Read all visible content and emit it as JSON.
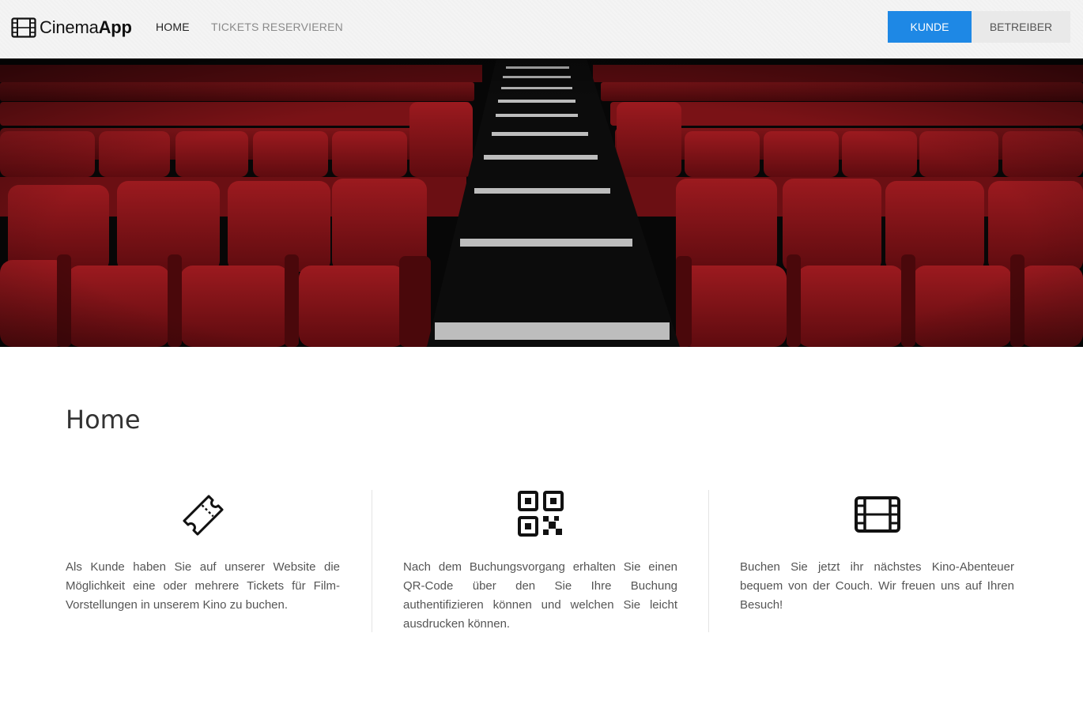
{
  "brand": {
    "name_light": "Cinema",
    "name_bold": "App",
    "icon": "film-icon"
  },
  "nav": {
    "items": [
      {
        "label": "HOME",
        "active": true
      },
      {
        "label": "TICKETS RESERVIEREN",
        "active": false
      }
    ]
  },
  "roles": {
    "kunde": "KUNDE",
    "betreiber": "BETREIBER",
    "active": "KUNDE"
  },
  "hero": {
    "image": "cinema-seats-hero"
  },
  "page": {
    "title": "Home"
  },
  "features": [
    {
      "icon": "ticket-icon",
      "text": "Als Kunde haben Sie auf unserer Website die Möglichkeit eine oder mehrere Tickets für Film-Vorstellungen in unserem Kino zu buchen."
    },
    {
      "icon": "qr-code-icon",
      "text": "Nach dem Buchungsvorgang erhalten Sie einen QR-Code über den Sie Ihre Buchung authentifizieren können und welchen Sie leicht ausdrucken können."
    },
    {
      "icon": "film-icon",
      "text": "Buchen Sie jetzt ihr nächstes Kino-Abenteuer bequem von der Couch. Wir freuen uns auf Ihren Besuch!"
    }
  ],
  "colors": {
    "accent": "#1e88e5",
    "navbar_bg": "#f4f4f4",
    "seat_red": "#8b1418"
  }
}
